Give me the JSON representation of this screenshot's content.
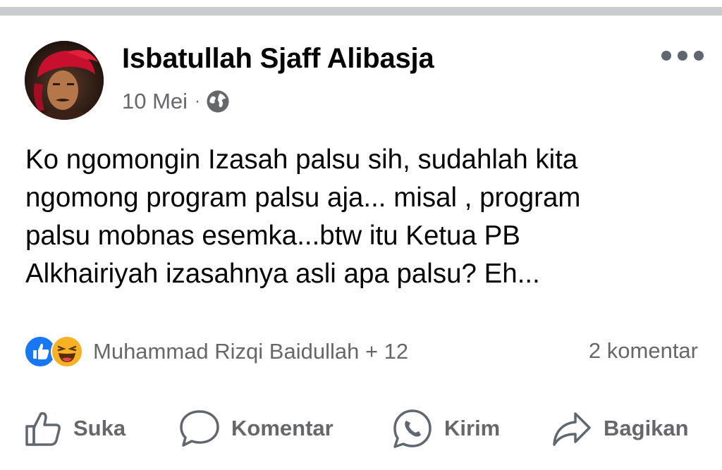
{
  "post": {
    "author": "Isbatullah Sjaff Alibasja",
    "date": "10 Mei",
    "separator": "·",
    "privacy_icon": "globe-icon",
    "text_lines": [
      "Ko ngomongin Izasah palsu sih, sudahlah kita",
      "ngomong program palsu aja... misal , program",
      "palsu mobnas esemka...btw itu Ketua PB",
      "Alkhairiyah izasahnya asli apa palsu? Eh..."
    ]
  },
  "reactions": {
    "icons": [
      "like-icon",
      "haha-icon"
    ],
    "summary": "Muhammad Rizqi Baidullah + 12",
    "comments": "2 komentar"
  },
  "actions": {
    "like": "Suka",
    "comment": "Komentar",
    "send": "Kirim",
    "share": "Bagikan"
  },
  "colors": {
    "divider": "#c9ccd1",
    "secondary_text": "#65676b",
    "like_blue": "#1877f2",
    "haha_yellow": "#f7b125"
  }
}
